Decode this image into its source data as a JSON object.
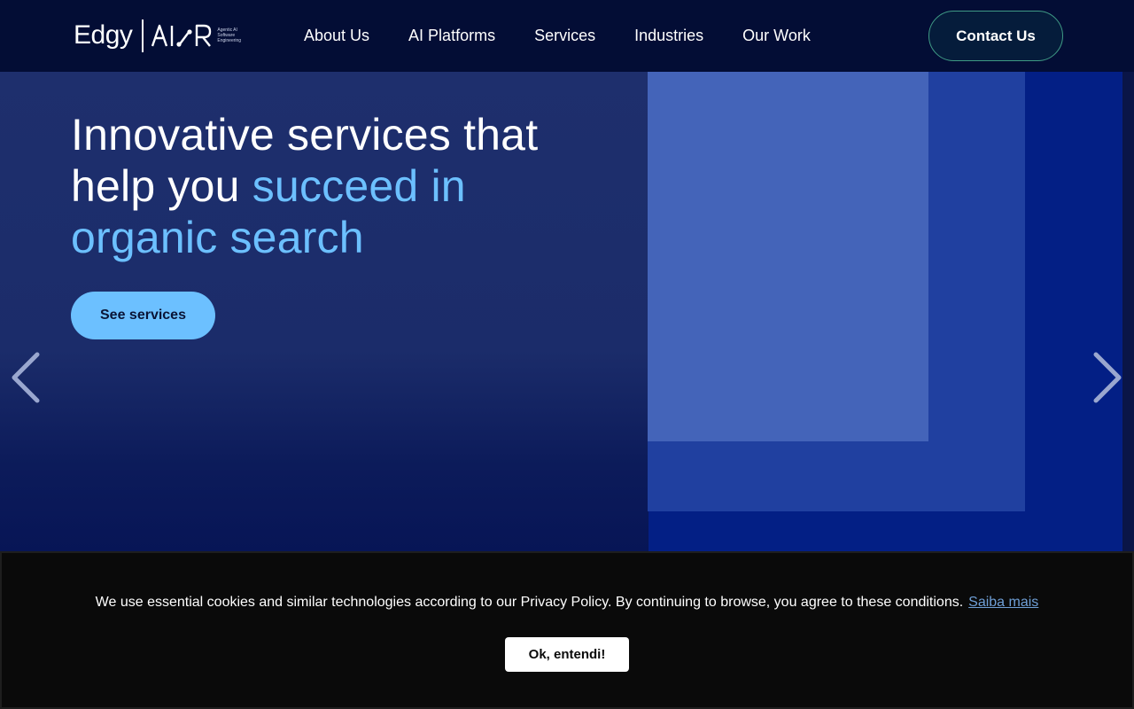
{
  "header": {
    "logo": {
      "brand": "Edgy",
      "product": "AI R",
      "tagline": [
        "Agentic AI",
        "Software",
        "Engineering"
      ]
    },
    "nav": [
      {
        "label": "About Us"
      },
      {
        "label": "AI Platforms"
      },
      {
        "label": "Services"
      },
      {
        "label": "Industries"
      },
      {
        "label": "Our Work"
      }
    ],
    "contact_label": "Contact Us"
  },
  "hero": {
    "title_plain": "Innovative services that help you ",
    "title_accent": "succeed in organic search",
    "cta_label": "See services",
    "prev_icon": "chevron-left-icon",
    "next_icon": "chevron-right-icon"
  },
  "cookie": {
    "message": "We use essential cookies and similar technologies according to our Privacy Policy. By continuing to browse, you agree to these conditions.",
    "link_label": "Saiba mais",
    "accept_label": "Ok, entendi!"
  },
  "colors": {
    "header_bg": "#030d35",
    "accent": "#6cc0ff",
    "contact_border": "#3f9a85",
    "cookie_bg": "#0a0a0a",
    "cookie_link": "#6f9fd6"
  }
}
